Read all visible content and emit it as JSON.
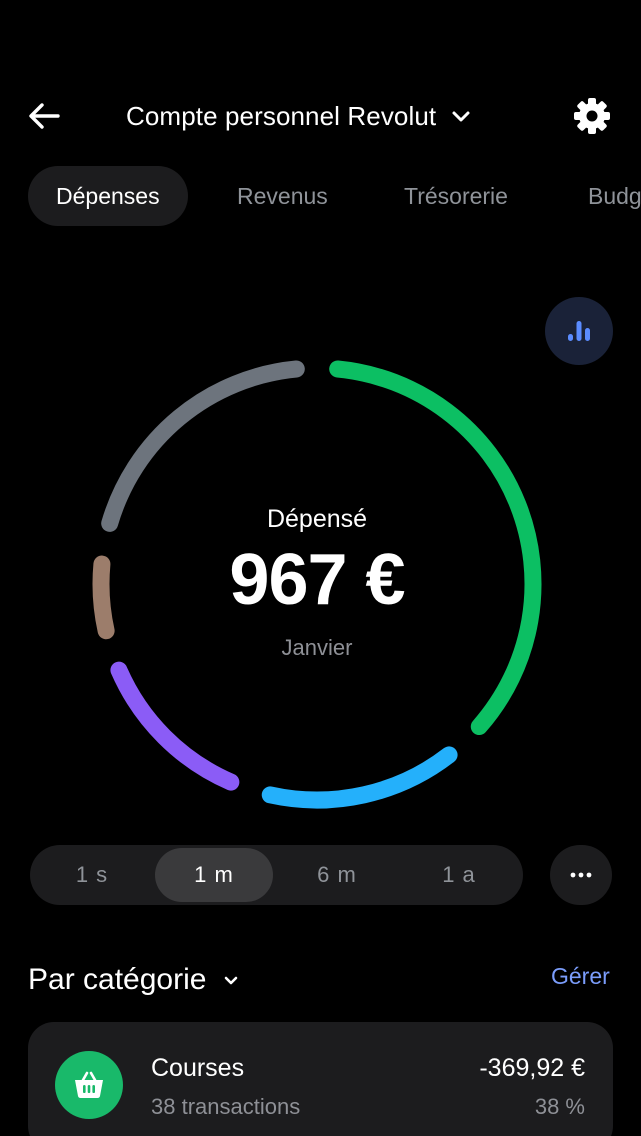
{
  "header": {
    "account_title": "Compte personnel Revolut"
  },
  "tabs": [
    {
      "label": "Dépenses",
      "active": true
    },
    {
      "label": "Revenus",
      "active": false
    },
    {
      "label": "Trésorerie",
      "active": false
    },
    {
      "label": "Budgets",
      "active": false
    }
  ],
  "summary": {
    "label": "Dépensé",
    "amount": "967 €",
    "period": "Janvier"
  },
  "chart_data": {
    "type": "pie",
    "style": "donut",
    "segments": [
      {
        "color": "#0cbf63",
        "share": 0.38
      },
      {
        "color": "#24b0fb",
        "share": 0.17
      },
      {
        "color": "#8b5cf6",
        "share": 0.15
      },
      {
        "color": "#9c7d6b",
        "share": 0.08
      },
      {
        "color": "#6d747d",
        "share": 0.22
      }
    ]
  },
  "periods": [
    {
      "label": "1 s",
      "active": false
    },
    {
      "label": "1 m",
      "active": true
    },
    {
      "label": "6 m",
      "active": false
    },
    {
      "label": "1 a",
      "active": false
    }
  ],
  "categories_section": {
    "title": "Par catégorie",
    "manage_label": "Gérer",
    "items": [
      {
        "name": "Courses",
        "transactions": "38 transactions",
        "amount": "-369,92 €",
        "percent": "38 %",
        "icon": "basket-icon",
        "color": "#19b96a"
      }
    ]
  },
  "colors": {
    "accent": "#7b9dfb",
    "background": "#000000",
    "card": "#1c1c1e"
  }
}
